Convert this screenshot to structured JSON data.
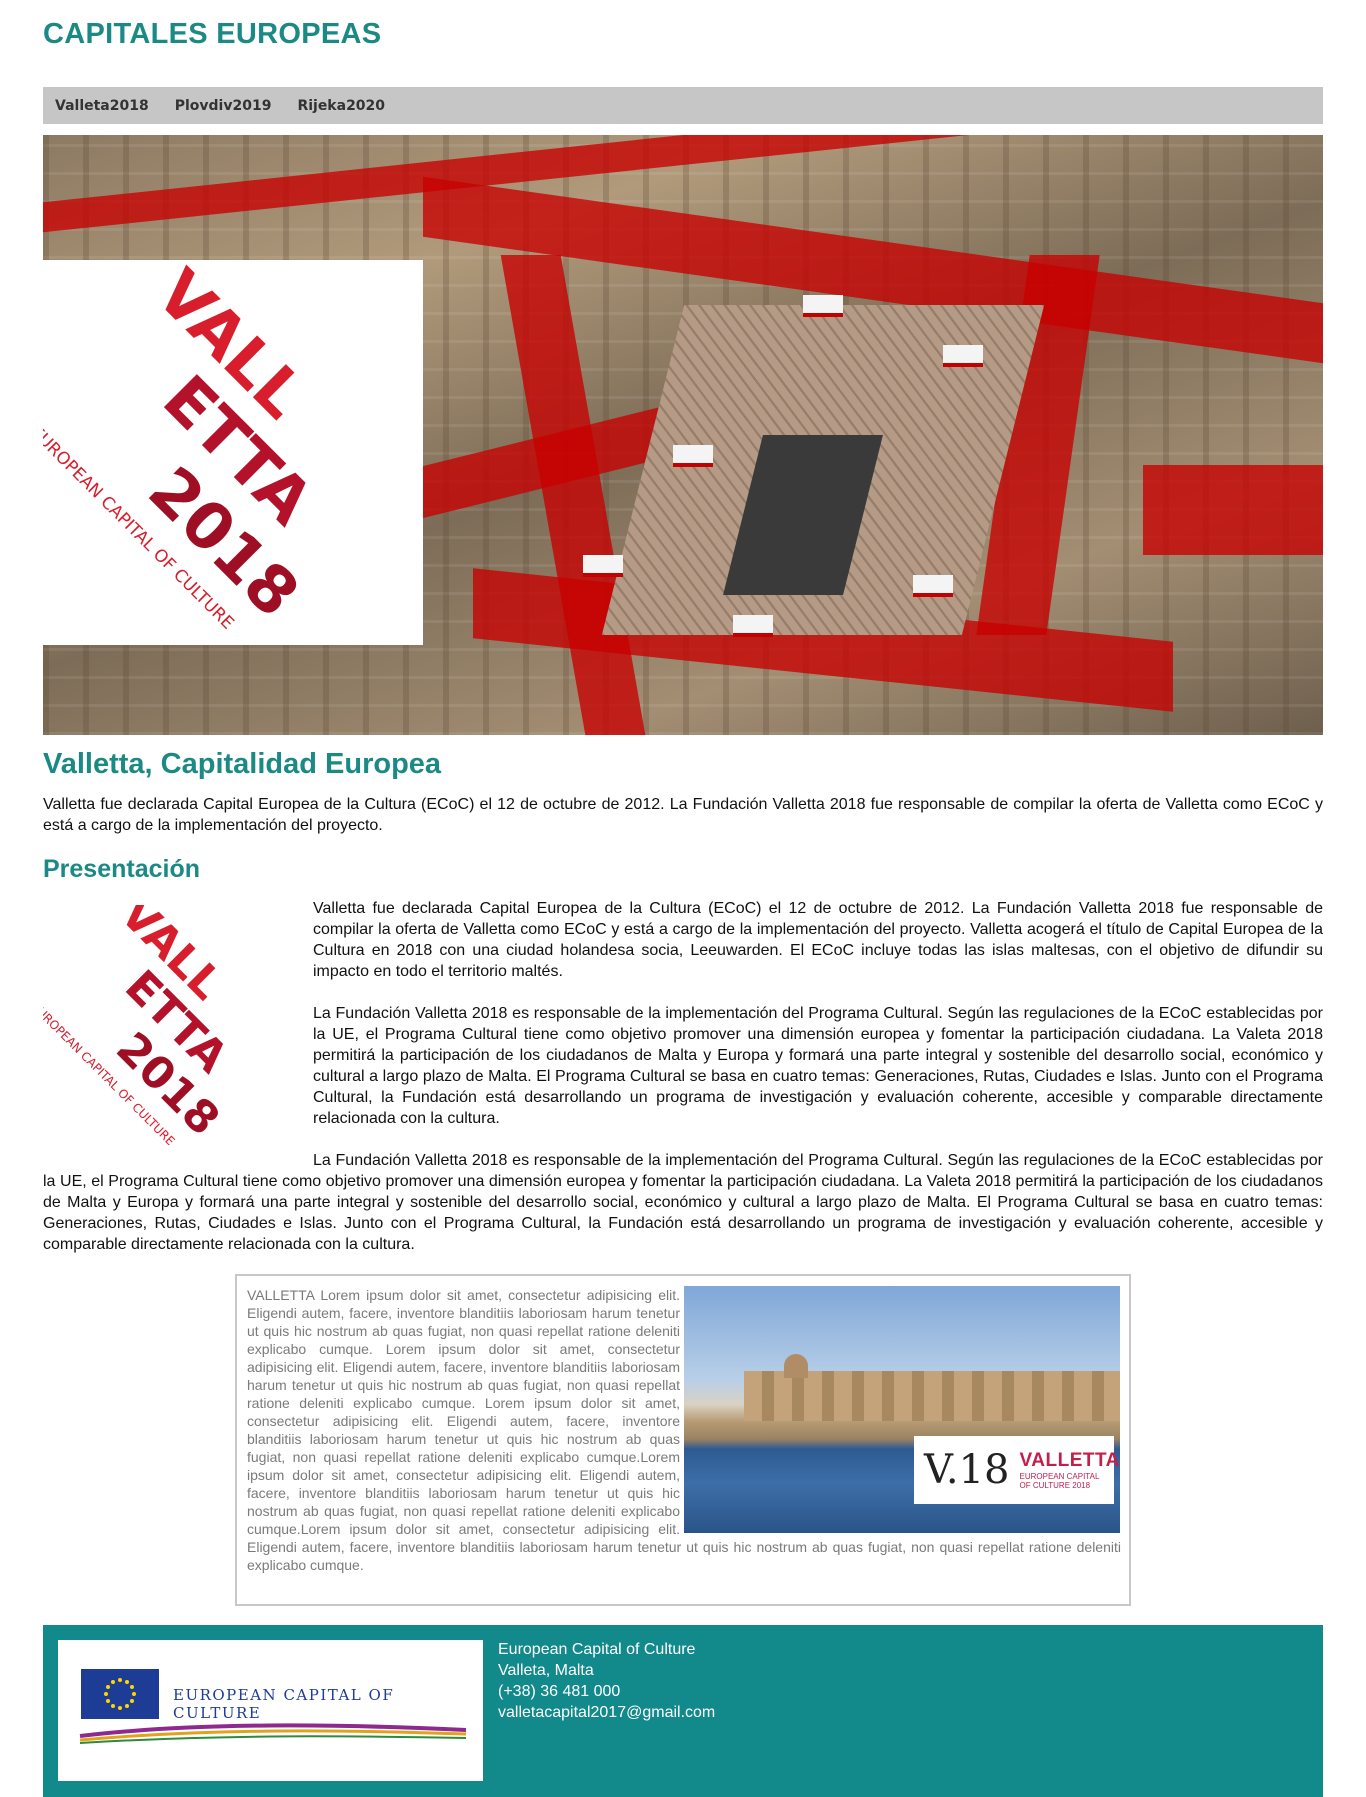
{
  "site": {
    "title": "CAPITALES EUROPEAS"
  },
  "nav": {
    "items": [
      "Valleta2018",
      "Plovdiv2019",
      "Rijeka2020"
    ]
  },
  "logo": {
    "top": "VALL",
    "middle": "ETTA",
    "bottom": "2018",
    "tagline": "EUROPEAN CAPITAL OF CULTURE"
  },
  "main": {
    "heading": "Valletta, Capitalidad Europea",
    "intro": "Valletta fue declarada Capital Europea de la Cultura (ECoC) el 12 de octubre de 2012. La Fundación Valletta 2018 fue responsable de compilar la oferta de Valletta como ECoC y está a cargo de la implementación del proyecto.",
    "subheading": "Presentación",
    "p1": "Valletta fue declarada Capital Europea de la Cultura (ECoC) el 12 de octubre de 2012. La Fundación Valletta 2018 fue responsable de compilar la oferta de Valletta como ECoC y está a cargo de la implementación del proyecto. Valletta acogerá el título de Capital Europea de la Cultura en 2018 con una ciudad holandesa socia, Leeuwarden. El ECoC incluye todas las islas maltesas, con el objetivo de difundir su impacto en todo el territorio maltés.",
    "p2": "La Fundación Valletta 2018 es responsable de la implementación del Programa Cultural. Según las regulaciones de la ECoC establecidas por la UE, el Programa Cultural tiene como objetivo promover una dimensión europea y fomentar la participación ciudadana. La Valeta 2018 permitirá la participación de los ciudadanos de Malta y Europa y formará una parte integral y sostenible del desarrollo social, económico y cultural a largo plazo de Malta. El Programa Cultural se basa en cuatro temas: Generaciones, Rutas, Ciudades e Islas. Junto con el Programa Cultural, la Fundación está desarrollando un programa de investigación y evaluación coherente, accesible y comparable directamente relacionada con la cultura.",
    "p3": "La Fundación Valletta 2018 es responsable de la implementación del Programa Cultural. Según las regulaciones de la ECoC establecidas por la UE, el Programa Cultural tiene como objetivo promover una dimensión europea y fomentar la participación ciudadana. La Valeta 2018 permitirá la participación de los ciudadanos de Malta y Europa y formará una parte integral y sostenible del desarrollo social, económico y cultural a largo plazo de Malta. El Programa Cultural se basa en cuatro temas: Generaciones, Rutas, Ciudades e Islas. Junto con el Programa Cultural, la Fundación está desarrollando un programa de investigación y evaluación coherente, accesible y comparable directamente relacionada con la cultura."
  },
  "article": {
    "text": "VALLETTA Lorem ipsum dolor sit amet, consectetur adipisicing elit. Eligendi autem, facere, inventore blanditiis laboriosam harum tenetur ut quis hic nostrum ab quas fugiat, non quasi repellat ratione deleniti explicabo cumque. Lorem ipsum dolor sit amet, consectetur adipisicing elit. Eligendi autem, facere, inventore blanditiis laboriosam harum tenetur ut quis hic nostrum ab quas fugiat, non quasi repellat ratione deleniti explicabo cumque. Lorem ipsum dolor sit amet, consectetur adipisicing elit. Eligendi autem, facere, inventore blanditiis laboriosam harum tenetur ut quis hic nostrum ab quas fugiat, non quasi repellat ratione deleniti explicabo cumque.Lorem ipsum dolor sit amet, consectetur adipisicing elit. Eligendi autem, facere, inventore blanditiis laboriosam harum tenetur ut quis hic nostrum ab quas fugiat, non quasi repellat ratione deleniti explicabo cumque.Lorem ipsum dolor sit amet, consectetur adipisicing elit. Eligendi autem, facere, inventore blanditiis laboriosam harum tenetur ut quis hic nostrum ab quas fugiat, non quasi repellat ratione deleniti explicabo cumque.",
    "stamp": {
      "mark": "V.18",
      "title": "VALLETTA",
      "sub1": "EUROPEAN CAPITAL",
      "sub2": "OF CULTURE 2018"
    }
  },
  "footer": {
    "logo_text": "EUROPEAN CAPITAL OF CULTURE",
    "info": [
      "European Capital of Culture",
      "Valleta, Malta",
      "(+38) 36 481 000",
      "valletacapital2017@gmail.com"
    ]
  },
  "colors": {
    "accent": "#1b8a85",
    "footer_bg": "#12898a",
    "nav_bg": "#c6c6c6",
    "logo_red": "#c8102e"
  }
}
